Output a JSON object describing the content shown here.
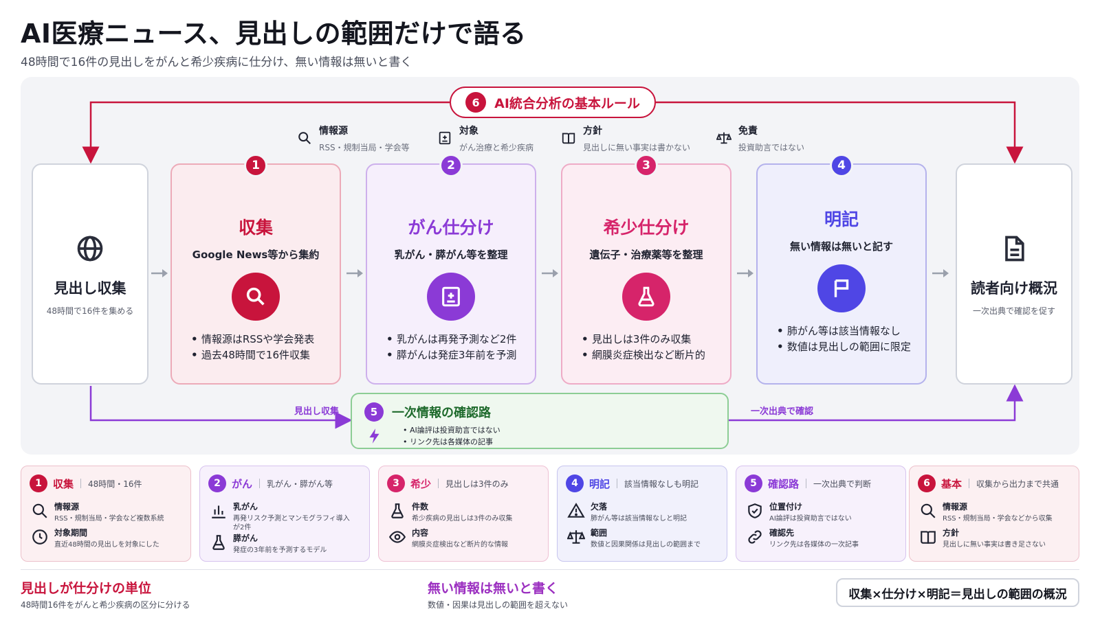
{
  "header": {
    "title": "AI医療ニュース、見出しの範囲だけで語る",
    "subtitle": "48時間で16件の見出しをがんと希少疾病に仕分け、無い情報は無いと書く"
  },
  "rule": {
    "num": "6",
    "label": "AI統合分析の基本ルール"
  },
  "meta": [
    {
      "title": "情報源",
      "sub": "RSS・規制当局・学会等",
      "icon": "search-icon"
    },
    {
      "title": "対象",
      "sub": "がん治療と希少疾病",
      "icon": "medical-box-icon"
    },
    {
      "title": "方針",
      "sub": "見出しに無い事実は書かない",
      "icon": "book-icon"
    },
    {
      "title": "免責",
      "sub": "投資助言ではない",
      "icon": "scale-icon"
    }
  ],
  "left_card": {
    "title": "見出し収集",
    "sub": "48時間で16件を集める",
    "icon": "globe-icon"
  },
  "right_card": {
    "title": "読者向け概況",
    "sub": "一次出典で確認を促す",
    "icon": "document-icon"
  },
  "steps": [
    {
      "num": "1",
      "title": "収集",
      "sub": "Google News等から集約",
      "icon": "search-icon",
      "color": "#c8143c",
      "bullets": [
        "情報源はRSSや学会発表",
        "過去48時間で16件収集"
      ]
    },
    {
      "num": "2",
      "title": "がん仕分け",
      "sub": "乳がん・膵がん等を整理",
      "icon": "medical-box-icon",
      "color": "#8b3ad6",
      "bullets": [
        "乳がんは再発予測など2件",
        "膵がんは発症3年前を予測"
      ]
    },
    {
      "num": "3",
      "title": "希少仕分け",
      "sub": "遺伝子・治療薬等を整理",
      "icon": "flask-icon",
      "color": "#d6246a",
      "bullets": [
        "見出しは3件のみ収集",
        "網膜炎症検出など断片的"
      ]
    },
    {
      "num": "4",
      "title": "明記",
      "sub": "無い情報は無いと記す",
      "icon": "flag-icon",
      "color": "#4f46e5",
      "bullets": [
        "肺がん等は該当情報なし",
        "数値は見出しの範囲に限定"
      ]
    }
  ],
  "confirm": {
    "num": "5",
    "title": "一次情報の確認路",
    "lines": [
      "AI論評は投資助言ではない",
      "リンク先は各媒体の記事"
    ],
    "left_label": "見出し収集",
    "right_label": "一次出典で確認"
  },
  "mini_cards": [
    {
      "num": "1",
      "title": "収集",
      "desc": "48時間・16件",
      "color": "#c8143c",
      "rows": [
        {
          "icon": "search-icon",
          "title": "情報源",
          "sub": "RSS・規制当局・学会など複数系統"
        },
        {
          "icon": "clock-icon",
          "title": "対象期間",
          "sub": "直近48時間の見出しを対象にした"
        }
      ]
    },
    {
      "num": "2",
      "title": "がん",
      "desc": "乳がん・膵がん等",
      "color": "#8b3ad6",
      "rows": [
        {
          "icon": "bar-chart-icon",
          "title": "乳がん",
          "sub": "再発リスク予測とマンモグラフィ導入が2件"
        },
        {
          "icon": "flask-icon",
          "title": "膵がん",
          "sub": "発症の3年前を予測するモデル"
        }
      ]
    },
    {
      "num": "3",
      "title": "希少",
      "desc": "見出しは3件のみ",
      "color": "#d6246a",
      "rows": [
        {
          "icon": "flask-icon",
          "title": "件数",
          "sub": "希少疾病の見出しは3件のみ収集"
        },
        {
          "icon": "eye-icon",
          "title": "内容",
          "sub": "網膜炎症検出など断片的な情報"
        }
      ]
    },
    {
      "num": "4",
      "title": "明記",
      "desc": "該当情報なしも明記",
      "color": "#4f46e5",
      "rows": [
        {
          "icon": "warning-icon",
          "title": "欠落",
          "sub": "肺がん等は該当情報なしと明記"
        },
        {
          "icon": "scale-icon",
          "title": "範囲",
          "sub": "数値と因果関係は見出しの範囲まで"
        }
      ]
    },
    {
      "num": "5",
      "title": "確認路",
      "desc": "一次出典で判断",
      "color": "#8b3ad6",
      "rows": [
        {
          "icon": "shield-icon",
          "title": "位置付け",
          "sub": "AI論評は投資助言ではない"
        },
        {
          "icon": "link-icon",
          "title": "確認先",
          "sub": "リンク先は各媒体の一次記事"
        }
      ]
    },
    {
      "num": "6",
      "title": "基本",
      "desc": "収集から出力まで共通",
      "color": "#c8143c",
      "rows": [
        {
          "icon": "search-icon",
          "title": "情報源",
          "sub": "RSS・規制当局・学会などから収集"
        },
        {
          "icon": "book-icon",
          "title": "方針",
          "sub": "見出しに無い事実は書き足さない"
        }
      ]
    }
  ],
  "footer": {
    "left_title": "見出しが仕分けの単位",
    "left_sub": "48時間16件をがんと希少疾病の区分に分ける",
    "mid_title": "無い情報は無いと書く",
    "mid_sub": "数値・因果は見出しの範囲を超えない",
    "formula": "収集×仕分け×明記＝見出しの範囲の概況"
  }
}
